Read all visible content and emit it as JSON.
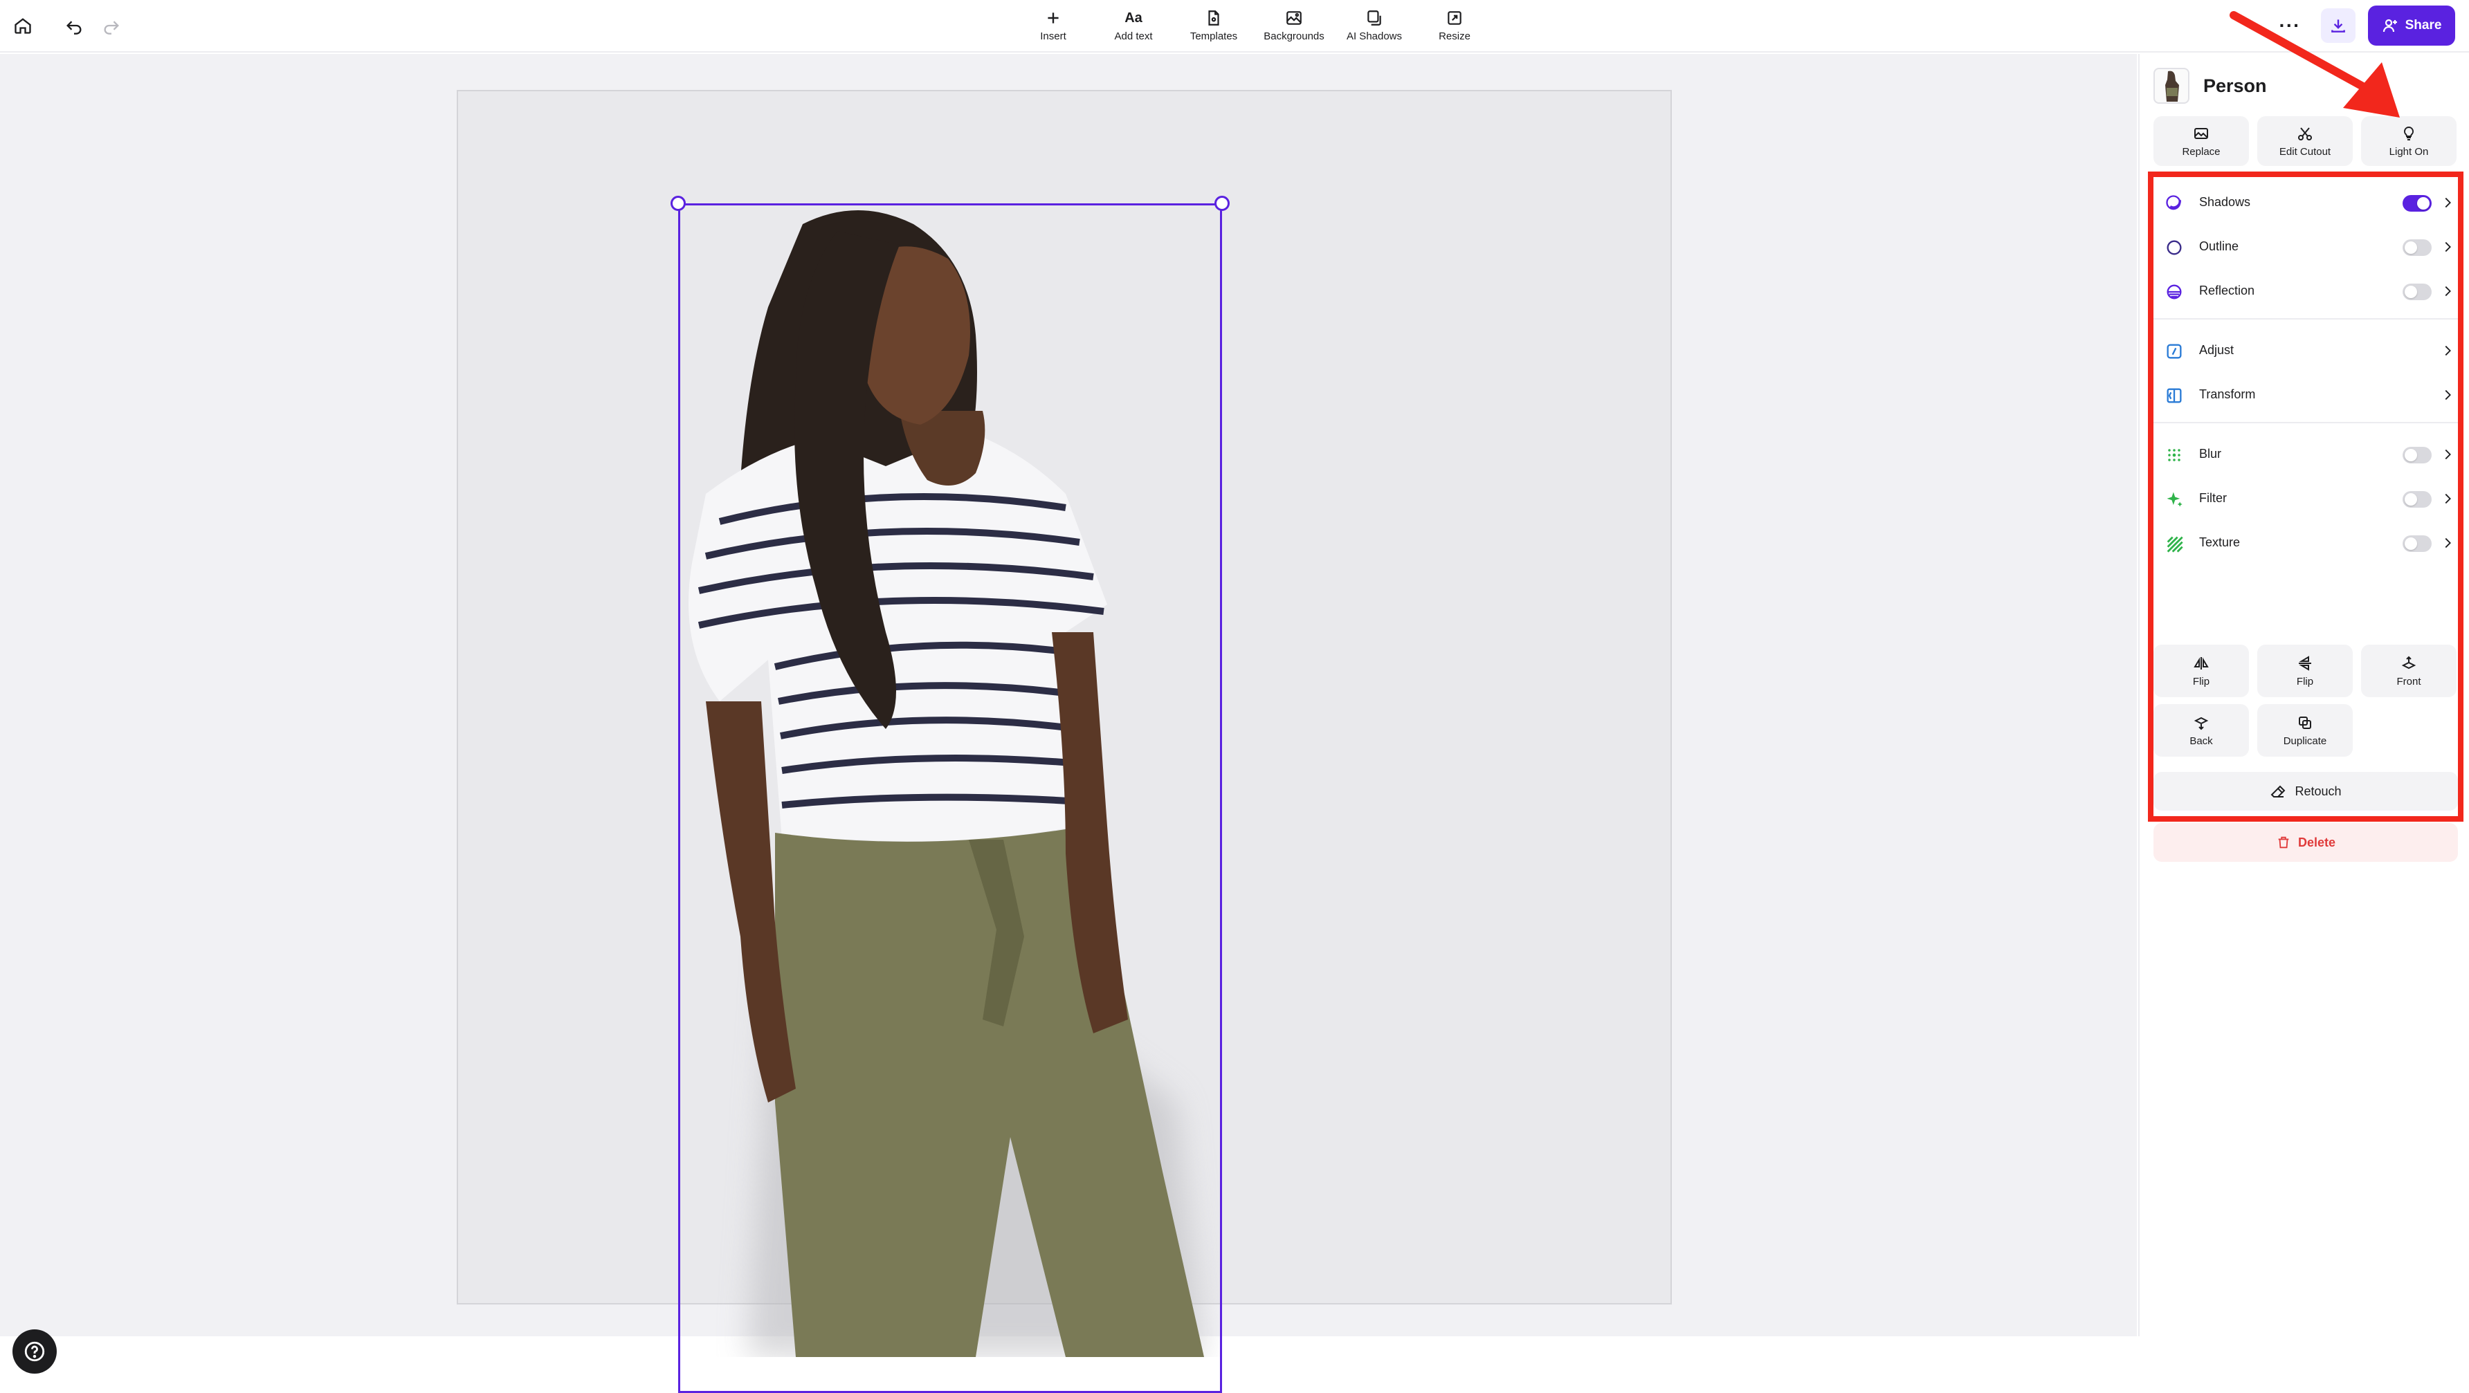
{
  "toolbar": {
    "insert": "Insert",
    "add_text_glyph": "Aa",
    "add_text": "Add text",
    "templates": "Templates",
    "backgrounds": "Backgrounds",
    "ai_shadows": "AI Shadows",
    "resize": "Resize",
    "more": "···",
    "share": "Share"
  },
  "panel": {
    "title": "Person",
    "actions": [
      "Replace",
      "Edit Cutout",
      "Light On"
    ],
    "properties": [
      {
        "name": "Shadows",
        "toggle": true,
        "on": true,
        "icon": "shadows-icon"
      },
      {
        "name": "Outline",
        "toggle": true,
        "on": false,
        "icon": "outline-icon"
      },
      {
        "name": "Reflection",
        "toggle": true,
        "on": false,
        "icon": "reflection-icon"
      },
      {
        "name": "Adjust",
        "toggle": false,
        "icon": "adjust-icon"
      },
      {
        "name": "Transform",
        "toggle": false,
        "icon": "transform-icon"
      },
      {
        "name": "Blur",
        "toggle": true,
        "on": false,
        "icon": "blur-icon"
      },
      {
        "name": "Filter",
        "toggle": true,
        "on": false,
        "icon": "filter-icon"
      },
      {
        "name": "Texture",
        "toggle": true,
        "on": false,
        "icon": "texture-icon"
      }
    ],
    "arrange": {
      "flip_h": "Flip",
      "flip_v": "Flip",
      "front": "Front",
      "back": "Back",
      "duplicate": "Duplicate"
    },
    "retouch": "Retouch",
    "delete": "Delete"
  },
  "colors": {
    "accent": "#5a22e0",
    "annotation": "#f2271c",
    "danger": "#e03a3a"
  }
}
